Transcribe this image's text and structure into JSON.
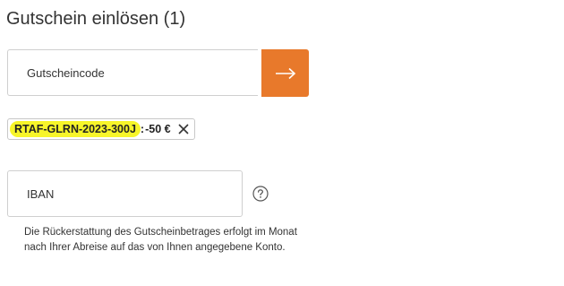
{
  "voucher": {
    "heading": "Gutschein einlösen (1)",
    "code_placeholder": "Gutscheincode",
    "code_value": "",
    "submit_icon": "arrow-right-icon",
    "brand_color": "#e8792b"
  },
  "applied_voucher": {
    "code": "RTAF-GLRN-2023-300J",
    "separator": ":",
    "discount": "-50 €",
    "remove_icon": "close-icon",
    "highlight_color": "#f7f52a"
  },
  "iban": {
    "placeholder": "IBAN",
    "value": "",
    "help_icon": "question-circle-icon",
    "hint": "Die Rückerstattung des Gutscheinbetrages erfolgt im Monat nach Ihrer Abreise auf das von Ihnen angegebene Konto."
  }
}
